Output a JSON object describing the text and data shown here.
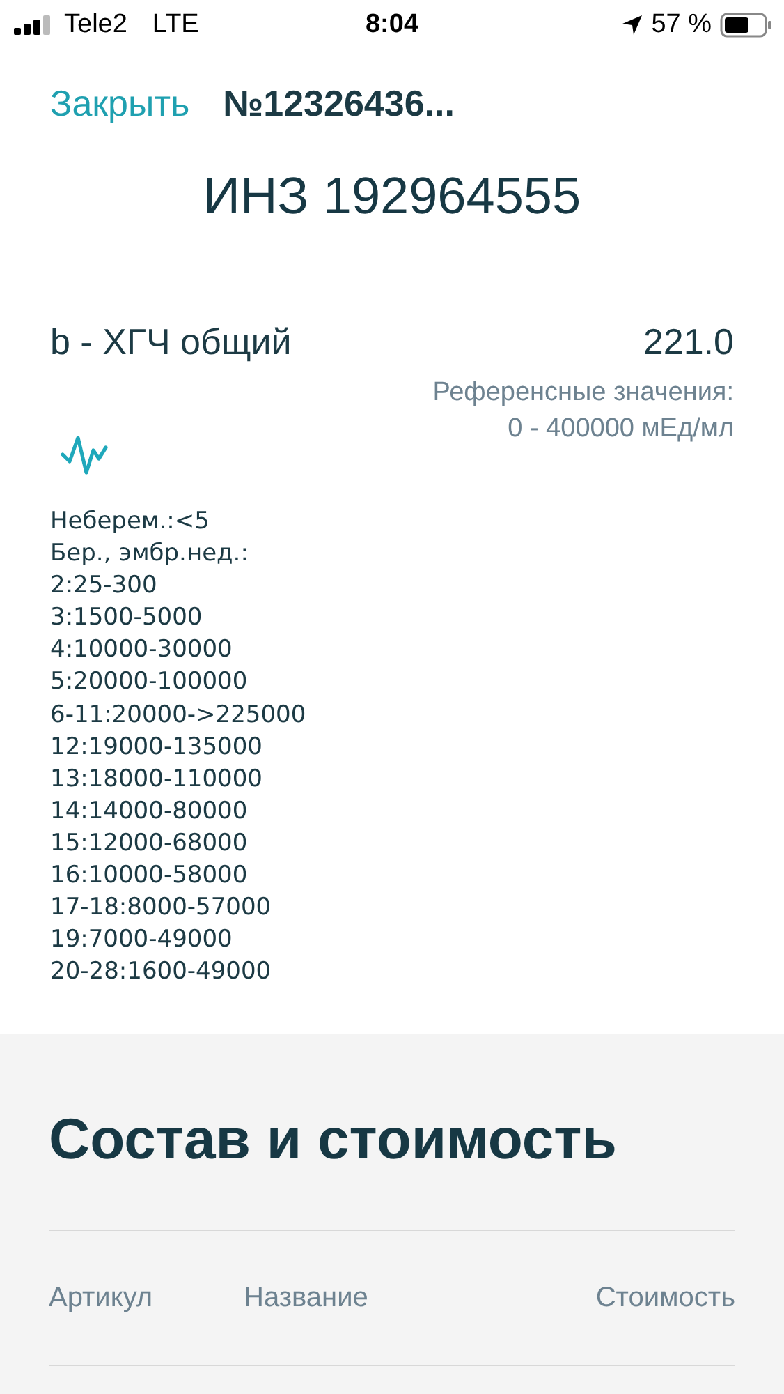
{
  "status_bar": {
    "carrier": "Tele2",
    "network": "LTE",
    "time": "8:04",
    "battery": "57 %"
  },
  "nav": {
    "close": "Закрыть",
    "title": "№12326436..."
  },
  "heading": "ИНЗ 192964555",
  "test": {
    "name": "b - ХГЧ общий",
    "value": "221.0",
    "reference_label": "Референсные значения:",
    "reference_range": "0 - 400000 мЕд/мл"
  },
  "notes": [
    "Неберем.:<5",
    "Бер., эмбр.нед.:",
    "2:25-300",
    "3:1500-5000",
    "4:10000-30000",
    "5:20000-100000",
    "6-11:20000->225000",
    "12:19000-135000",
    "13:18000-110000",
    "14:14000-80000",
    "15:12000-68000",
    "16:10000-58000",
    "17-18:8000-57000",
    "19:7000-49000",
    "20-28:1600-49000"
  ],
  "composition": {
    "title": "Состав и стоимость",
    "columns": [
      "Артикул",
      "Название",
      "Стоимость"
    ]
  }
}
